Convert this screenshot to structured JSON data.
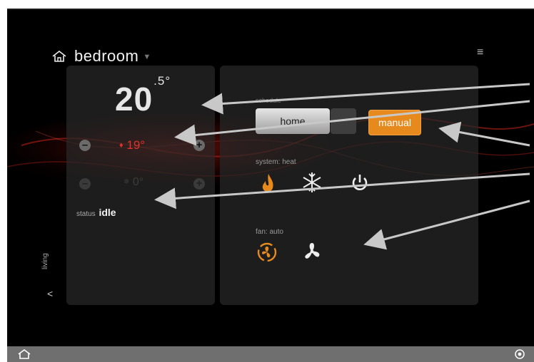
{
  "header": {
    "room_name": "bedroom"
  },
  "thermostat": {
    "current_temp_whole": "20",
    "current_temp_fraction": ".5°",
    "heat_setpoint": "19°",
    "cool_setpoint": "0°",
    "status_label": "status",
    "status_value": "idle"
  },
  "navigation": {
    "prev_room": "living"
  },
  "schedule": {
    "label": "schedule",
    "selected": "home",
    "override": "manual"
  },
  "system": {
    "label": "system:",
    "mode": "heat"
  },
  "fan": {
    "label": "fan:",
    "mode": "auto"
  },
  "colors": {
    "accent": "#e68a1e",
    "heat": "#e0322b",
    "background": "#000000",
    "bottom_bar": "#6f6f6f"
  },
  "icons": [
    "home-icon",
    "menu-icon",
    "minus-icon",
    "plus-icon",
    "flame-icon",
    "snowflake-icon",
    "power-icon",
    "fan-auto-icon",
    "fan-icon",
    "chevron-left-icon",
    "gear-icon"
  ]
}
